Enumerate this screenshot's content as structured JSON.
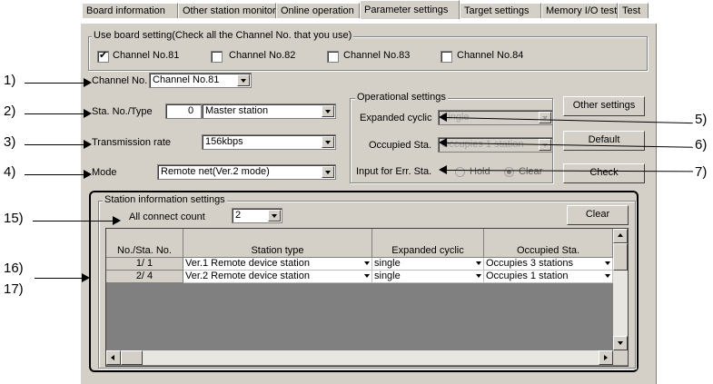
{
  "tabs": [
    "Board information",
    "Other station monitor",
    "Online operation",
    "Parameter settings",
    "Target settings",
    "Memory I/O test",
    "Test"
  ],
  "use_board": {
    "title": "Use board setting(Check all the Channel No. that you use)",
    "channels": [
      {
        "label": "Channel No.81",
        "checked": "✔"
      },
      {
        "label": "Channel No.82",
        "checked": ""
      },
      {
        "label": "Channel No.83",
        "checked": ""
      },
      {
        "label": "Channel No.84",
        "checked": ""
      }
    ]
  },
  "channel": {
    "label": "Channel No.",
    "value": "Channel No.81"
  },
  "sta": {
    "label": "Sta. No./Type",
    "number": "0",
    "type": "Master station"
  },
  "rate": {
    "label": "Transmission rate",
    "value": "156kbps"
  },
  "mode": {
    "label": "Mode",
    "value": "Remote net(Ver.2 mode)"
  },
  "operational": {
    "title": "Operational settings",
    "expanded_label": "Expanded cyclic",
    "expanded_value": "Single",
    "occupied_label": "Occupied Sta.",
    "occupied_value": "Occupies 1 station",
    "err_label": "Input for Err. Sta.",
    "hold": "Hold",
    "clear": "Clear"
  },
  "buttons": {
    "other": "Other settings",
    "default": "Default",
    "check": "Check",
    "clear": "Clear"
  },
  "station_info": {
    "title": "Station information settings",
    "count_label": "All connect count",
    "count_value": "2",
    "headers": [
      "No./Sta. No.",
      "Station type",
      "Expanded cyclic",
      "Occupied Sta."
    ],
    "rows": [
      {
        "no": "1/ 1",
        "type": "Ver.1 Remote device station",
        "cyclic": "single",
        "occupied": "Occupies 3 stations"
      },
      {
        "no": "2/ 4",
        "type": "Ver.2 Remote device station",
        "cyclic": "single",
        "occupied": "Occupies 1 station"
      }
    ]
  },
  "callouts": {
    "c1": "1)",
    "c2": "2)",
    "c3": "3)",
    "c4": "4)",
    "c5": "5)",
    "c6": "6)",
    "c7": "7)",
    "c15": "15)",
    "c16": "16)",
    "c17": "17)"
  }
}
